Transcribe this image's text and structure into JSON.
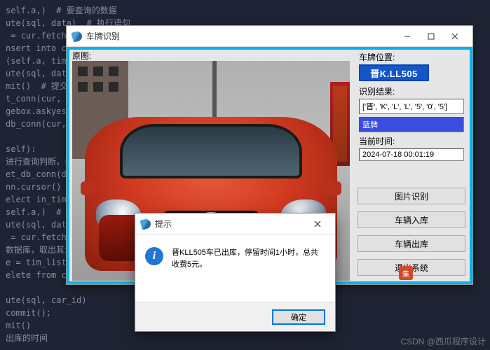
{
  "code_lines": [
    "self.a,)  # 要查询的数据",
    "ute(sql, data)  # 执行语句",
    " = cur.fetcha",
    "nsert into ca",
    "(self.a, time",
    "ute(sql, data",
    "mit()  # 提交",
    "t_conn(cur, c",
    "gebox.askyesn",
    "db_conn(cur, ",
    "",
    "self):",
    "进行查询判断，看",
    "et_db_conn(db",
    "nn.cursor()",
    "elect in_time",
    "self.a,)  # 要",
    "ute(sql, data",
    " = cur.fetcha",
    "数据库，取出其进",
    "e = tim_list[",
    "elete from ca",
    "",
    "ute(sql, car_id)",
    "commit();",
    "mit()",
    "出库的时间"
  ],
  "main_window": {
    "title": "车牌识别",
    "labels": {
      "original": "原图:",
      "plate_pos": "车牌位置:",
      "result": "识别结果:",
      "time": "当前时间:"
    },
    "plate_text": "晋K·LL505",
    "plate_crop_text": "晋K.LL505",
    "result_text": "['晋', 'K', 'L', 'L', '5', '0', '5']",
    "plate_color": "蓝牌",
    "current_time": "2024-07-18 00:01:19",
    "buttons": {
      "recognize": "图片识别",
      "in": "车辆入库",
      "out": "车辆出库",
      "exit": "退出系统"
    }
  },
  "dialog": {
    "title": "提示",
    "message": "晋KLL505车已出库，停留时间1小时，总共收费5元。",
    "ok": "确定"
  },
  "watermark": "CSDN @西瓜程序设计",
  "caiji_badge": "集"
}
